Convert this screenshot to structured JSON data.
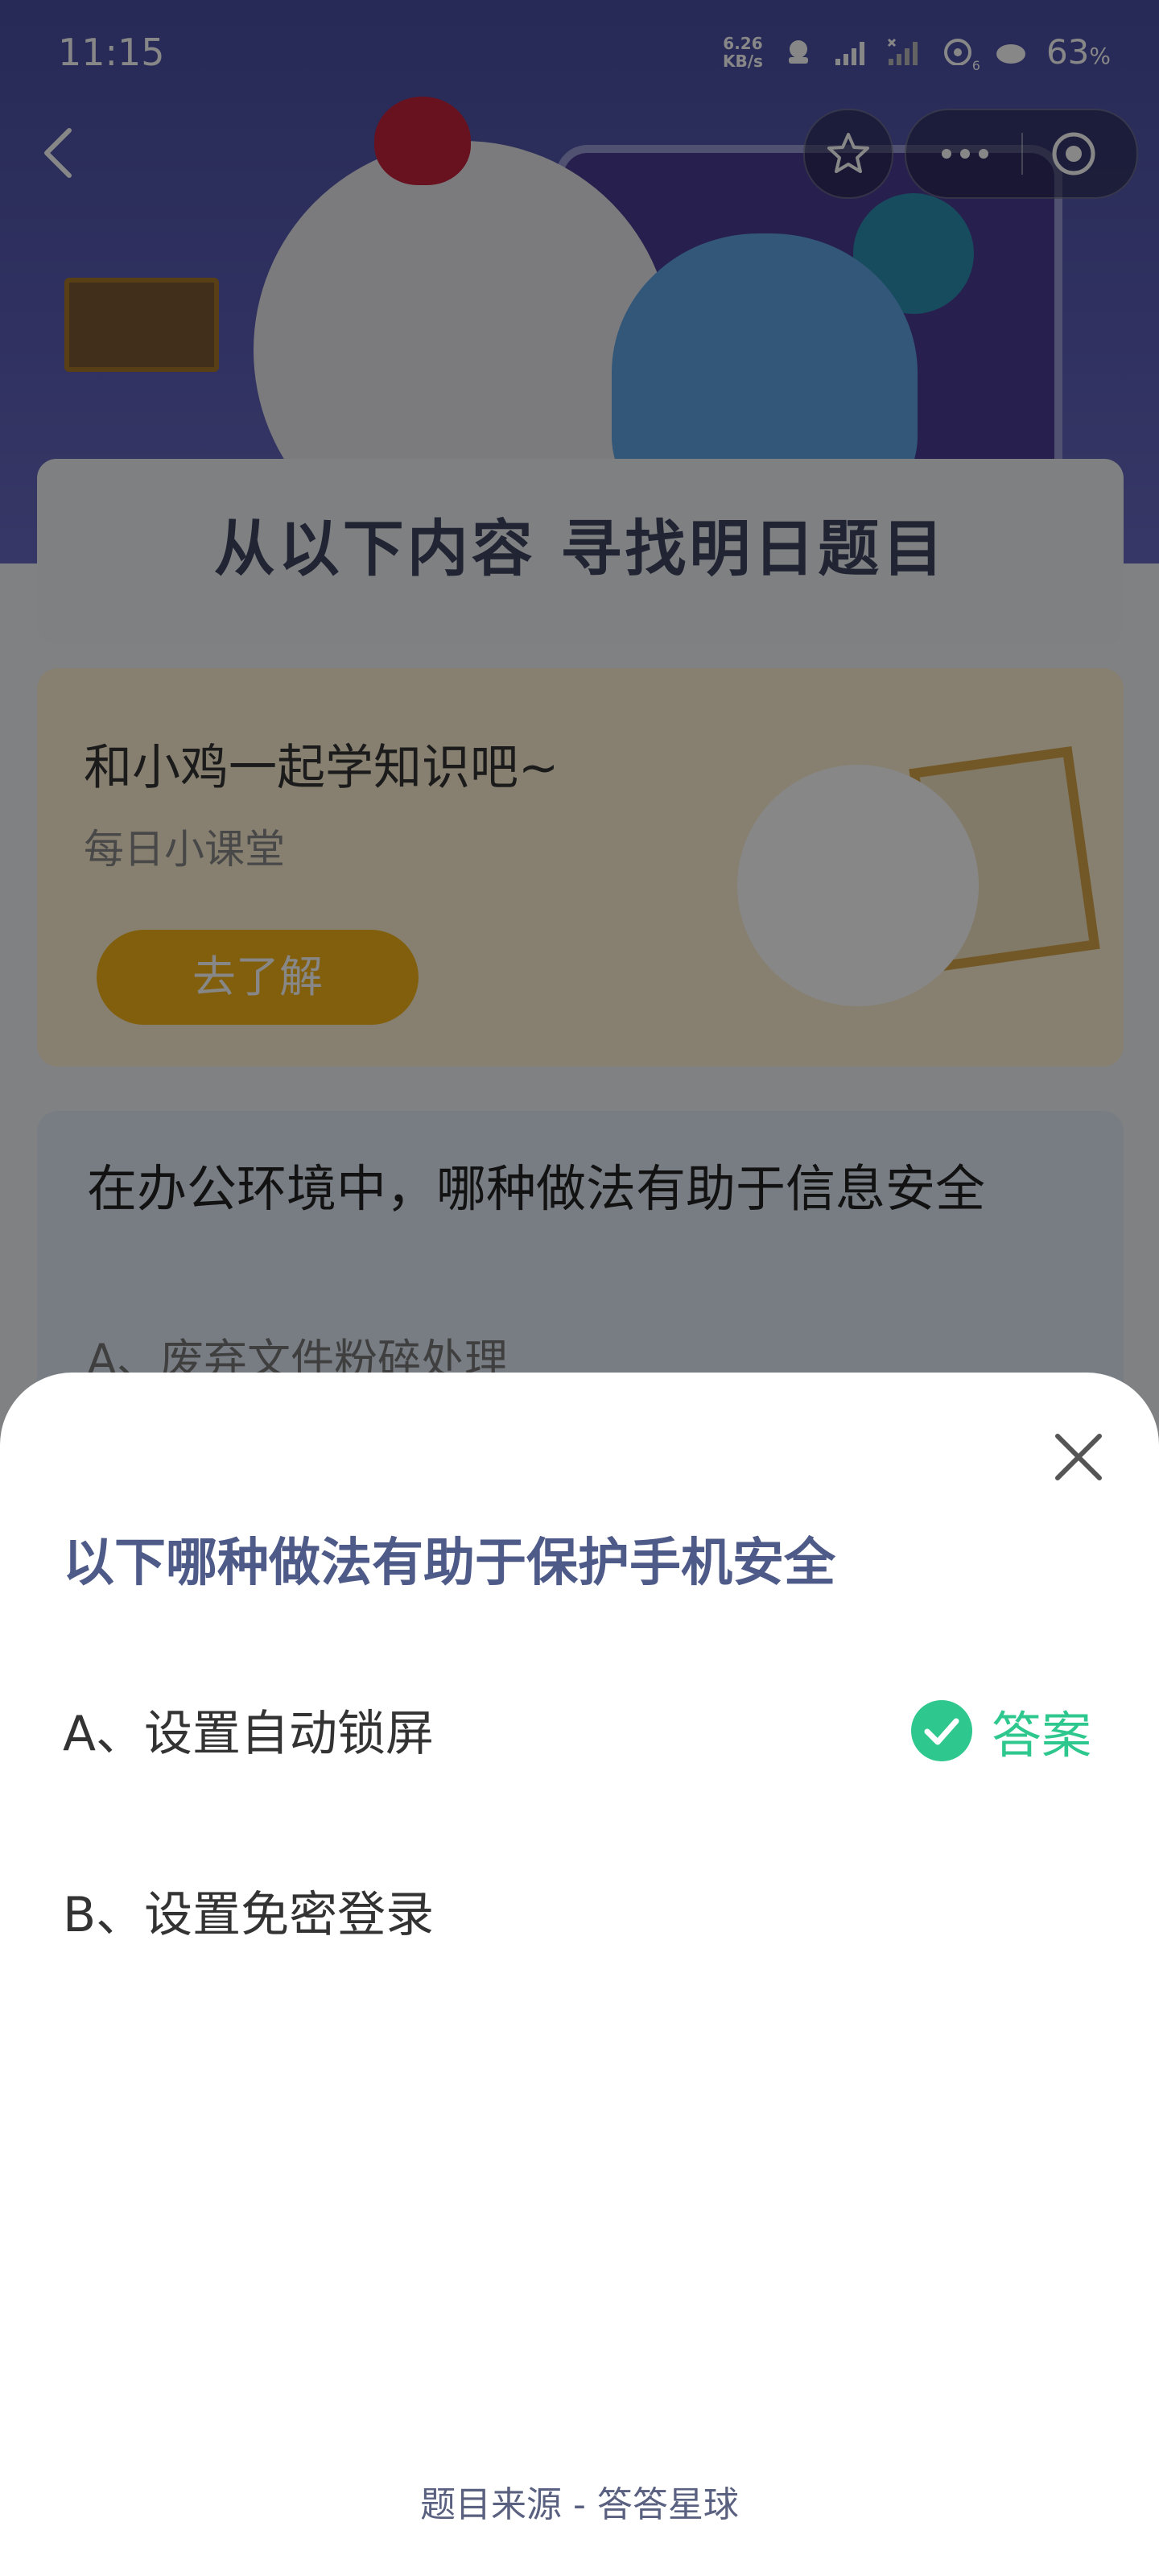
{
  "status_bar": {
    "time": "11:15",
    "net_speed_value": "6.26",
    "net_speed_unit": "KB/s",
    "battery": "63",
    "battery_unit": "%",
    "sim2_badge": "6"
  },
  "banner": {
    "title": "从以下内容  寻找明日题目"
  },
  "lesson_card": {
    "title": "和小鸡一起学知识吧~",
    "subtitle": "每日小课堂",
    "button": "去了解"
  },
  "question_card": {
    "question": "在办公环境中，哪种做法有助于信息安全",
    "option_a": "A、废弃文件粉碎处理"
  },
  "sheet": {
    "question": "以下哪种做法有助于保护手机安全",
    "options": [
      {
        "label": "A、设置自动锁屏",
        "is_answer": true
      },
      {
        "label": "B、设置免密登录",
        "is_answer": false
      }
    ],
    "answer_label": "答案",
    "source": "题目来源 - 答答星球"
  },
  "colors": {
    "accent_green": "#2ec78d",
    "question_blue": "#4e5a87",
    "hero_purple": "#4a4fa3",
    "button_yellow": "#f3b419"
  },
  "icons": [
    "back-icon",
    "star-icon",
    "more-icon",
    "target-icon",
    "close-icon",
    "check-icon"
  ]
}
